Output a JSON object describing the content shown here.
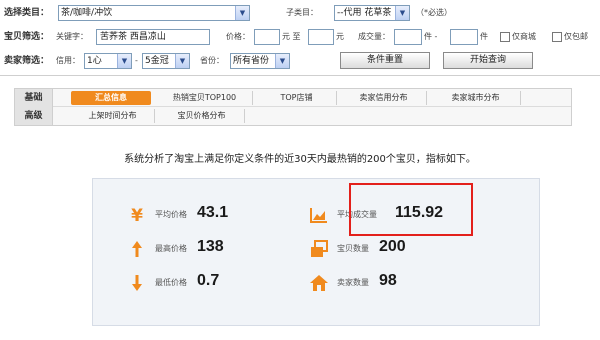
{
  "filters": {
    "category_label": "选择类目：",
    "category_value": "茶/咖啡/冲饮",
    "subcategory_label": "子类目：",
    "subcategory_value": "--代用  花草茶",
    "required_note": "（*必选）",
    "item_filter_label": "宝贝筛选：",
    "keyword_label": "关键字：",
    "keyword_value": "苦荞茶  西昌凉山",
    "price_label": "价格：",
    "price_unit_from": "元  至",
    "price_unit_to": "元",
    "sales_label": "成交量：",
    "sales_unit_from": "件  -",
    "sales_unit_to": "件",
    "mall_only_label": "仅商城",
    "postage_free_label": "仅包邮",
    "seller_filter_label": "卖家筛选：",
    "credit_label": "信用：",
    "credit_from": "1心",
    "credit_sep": "-",
    "credit_to": "5金冠",
    "province_label": "省份：",
    "province_value": "所有省份",
    "reset_button": "条件重置",
    "query_button": "开始查询"
  },
  "tabs": {
    "row1_head": "基础",
    "row1": [
      "汇总信息",
      "热销宝贝TOP100",
      "TOP店铺",
      "卖家信用分布",
      "卖家城市分布"
    ],
    "row2_head": "高级",
    "row2": [
      "上架时间分布",
      "宝贝价格分布"
    ]
  },
  "summary": "系统分析了淘宝上满足你定义条件的近30天内最热销的200个宝贝，指标如下。",
  "stats": {
    "avg_price": {
      "icon": "yen-icon",
      "label": "平均价格",
      "value": "43.1"
    },
    "avg_sales": {
      "icon": "area-chart-icon",
      "label": "平均成交量",
      "value": "115.92"
    },
    "max_price": {
      "icon": "arrow-up-icon",
      "label": "最高价格",
      "value": "138"
    },
    "item_count": {
      "icon": "stacked-boxes-icon",
      "label": "宝贝数量",
      "value": "200"
    },
    "min_price": {
      "icon": "arrow-down-icon",
      "label": "最低价格",
      "value": "0.7"
    },
    "seller_count": {
      "icon": "house-icon",
      "label": "卖家数量",
      "value": "98"
    }
  },
  "colors": {
    "accent_orange": "#f08a1e",
    "highlight_red": "#e3201b",
    "select_border": "#7f9db9"
  }
}
